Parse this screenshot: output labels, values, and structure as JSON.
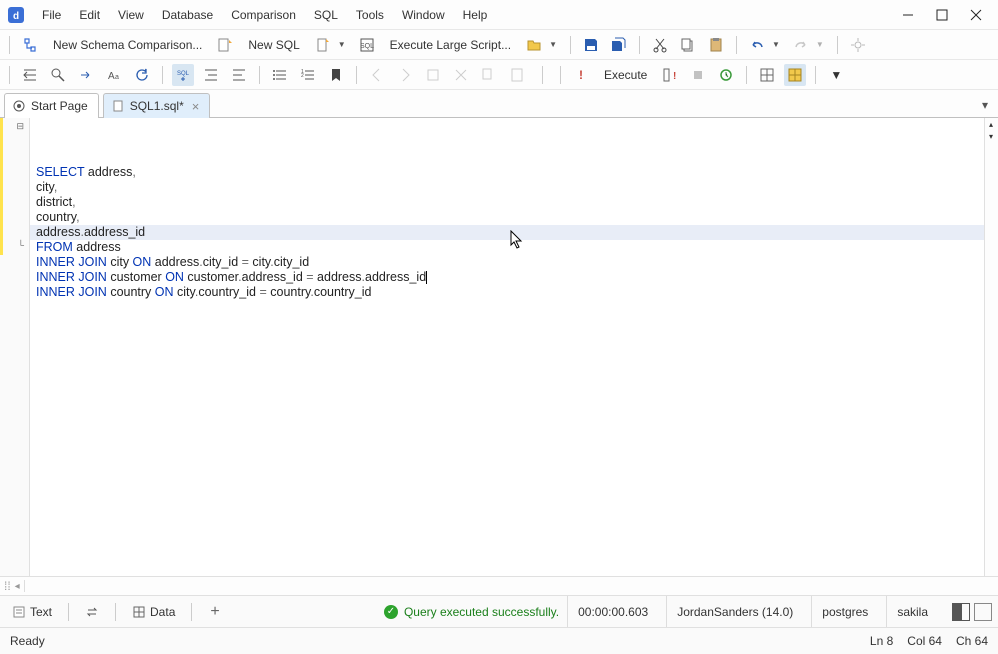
{
  "menu": {
    "items": [
      "File",
      "Edit",
      "View",
      "Database",
      "Comparison",
      "SQL",
      "Tools",
      "Window",
      "Help"
    ]
  },
  "toolbar1": {
    "newSchema": "New Schema Comparison...",
    "newSql": "New SQL",
    "execLarge": "Execute Large Script..."
  },
  "toolbar2": {
    "execute": "Execute"
  },
  "tabs": {
    "start": "Start Page",
    "sql1": "SQL1.sql*"
  },
  "code": {
    "lines": [
      [
        {
          "t": "SELECT",
          "c": "kw"
        },
        {
          "t": " address",
          "c": "ident"
        },
        {
          "t": ",",
          "c": "op"
        }
      ],
      [
        {
          "t": "city",
          "c": "ident"
        },
        {
          "t": ",",
          "c": "op"
        }
      ],
      [
        {
          "t": "district",
          "c": "ident"
        },
        {
          "t": ",",
          "c": "op"
        }
      ],
      [
        {
          "t": "country",
          "c": "ident"
        },
        {
          "t": ",",
          "c": "op"
        }
      ],
      [
        {
          "t": "address",
          "c": "ident"
        },
        {
          "t": ".",
          "c": "op"
        },
        {
          "t": "address_id",
          "c": "ident"
        }
      ],
      [
        {
          "t": "FROM",
          "c": "kw"
        },
        {
          "t": " address",
          "c": "ident"
        }
      ],
      [
        {
          "t": "INNER JOIN",
          "c": "kw"
        },
        {
          "t": " city ",
          "c": "ident"
        },
        {
          "t": "ON",
          "c": "kw"
        },
        {
          "t": " address",
          "c": "ident"
        },
        {
          "t": ".",
          "c": "op"
        },
        {
          "t": "city_id ",
          "c": "ident"
        },
        {
          "t": "=",
          "c": "op"
        },
        {
          "t": " city",
          "c": "ident"
        },
        {
          "t": ".",
          "c": "op"
        },
        {
          "t": "city_id",
          "c": "ident"
        }
      ],
      [
        {
          "t": "INNER JOIN",
          "c": "kw"
        },
        {
          "t": " customer ",
          "c": "ident"
        },
        {
          "t": "ON",
          "c": "kw"
        },
        {
          "t": " customer",
          "c": "ident"
        },
        {
          "t": ".",
          "c": "op"
        },
        {
          "t": "address_id ",
          "c": "ident"
        },
        {
          "t": "=",
          "c": "op"
        },
        {
          "t": " address",
          "c": "ident"
        },
        {
          "t": ".",
          "c": "op"
        },
        {
          "t": "address_id",
          "c": "ident"
        }
      ],
      [
        {
          "t": "INNER JOIN",
          "c": "kw"
        },
        {
          "t": " country ",
          "c": "ident"
        },
        {
          "t": "ON",
          "c": "kw"
        },
        {
          "t": " city",
          "c": "ident"
        },
        {
          "t": ".",
          "c": "op"
        },
        {
          "t": "country_id ",
          "c": "ident"
        },
        {
          "t": "=",
          "c": "op"
        },
        {
          "t": " country",
          "c": "ident"
        },
        {
          "t": ".",
          "c": "op"
        },
        {
          "t": "country_id",
          "c": "ident"
        }
      ]
    ],
    "highlightLine": 7,
    "caretLine": 7,
    "gutterMarkLines": 9
  },
  "results": {
    "textTab": "Text",
    "dataTab": "Data",
    "status": "Query executed successfully.",
    "elapsed": "00:00:00.603",
    "connection": "JordanSanders (14.0)",
    "user": "postgres",
    "database": "sakila"
  },
  "footer": {
    "status": "Ready",
    "ln": "Ln 8",
    "col": "Col 64",
    "ch": "Ch 64"
  }
}
